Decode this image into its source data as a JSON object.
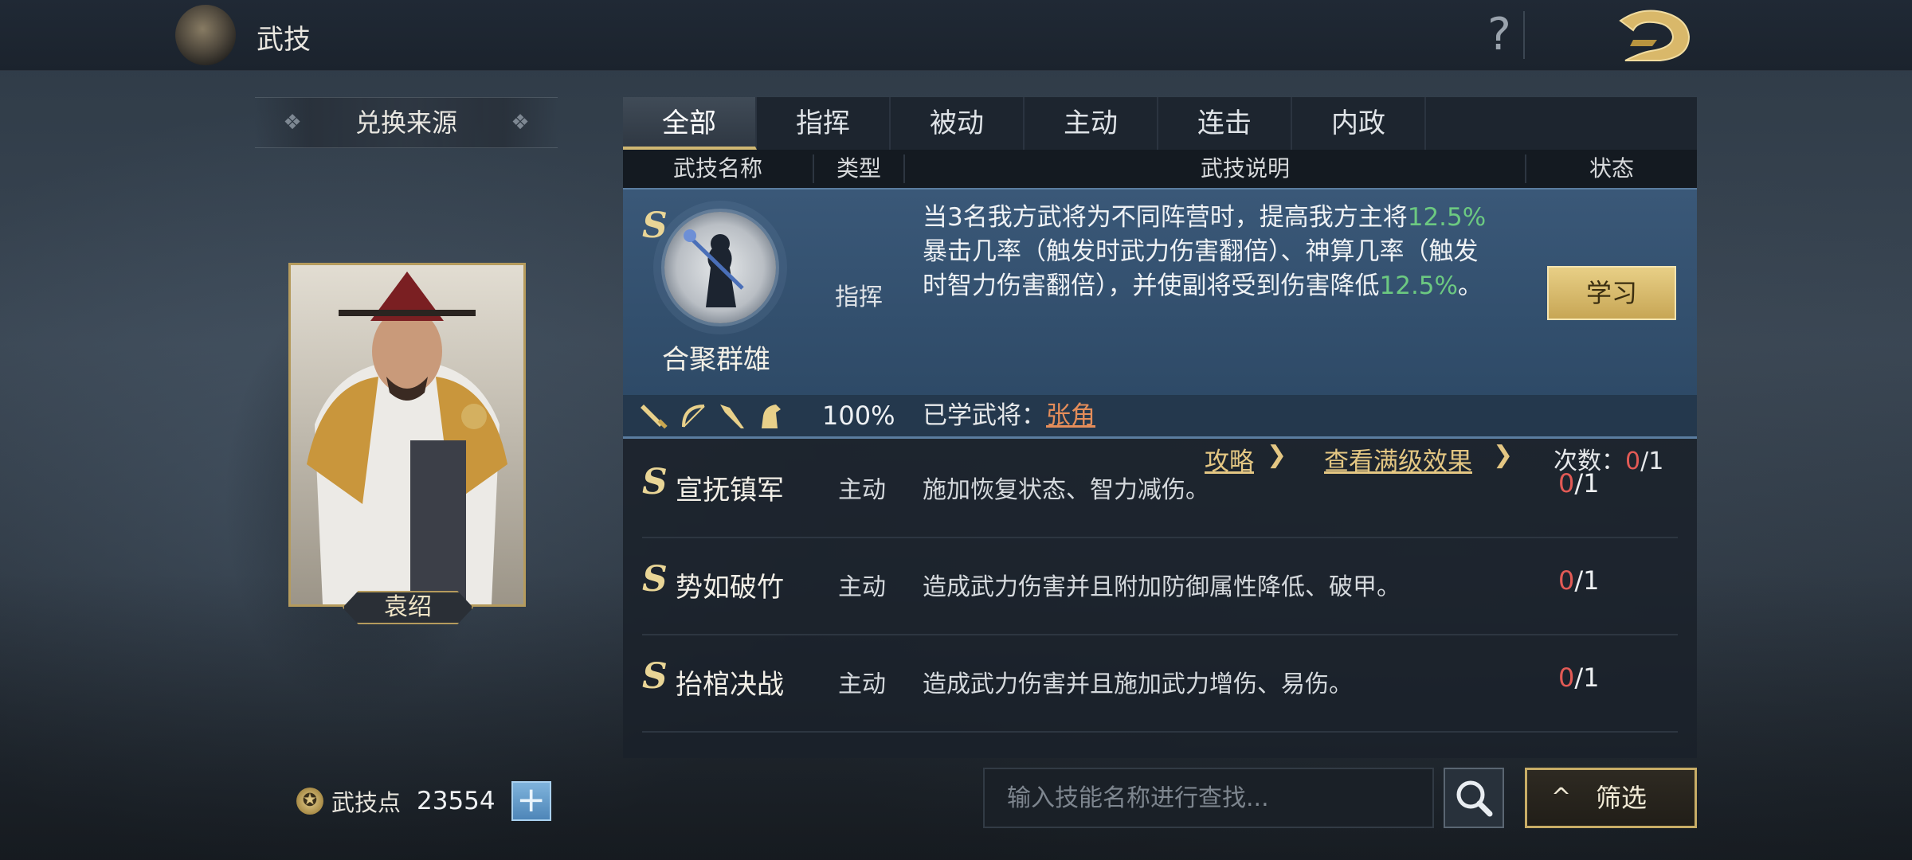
{
  "app": {
    "title": "武技"
  },
  "header": {
    "help_glyph": "?"
  },
  "left_panel": {
    "source_banner": "兑换来源",
    "general_name": "袁绍",
    "points_label": "武技点",
    "points_value": "23554",
    "add_glyph": "+"
  },
  "tabs": [
    {
      "label": "全部",
      "active": true
    },
    {
      "label": "指挥",
      "active": false
    },
    {
      "label": "被动",
      "active": false
    },
    {
      "label": "主动",
      "active": false
    },
    {
      "label": "连击",
      "active": false
    },
    {
      "label": "内政",
      "active": false
    }
  ],
  "columns": {
    "name": "武技名称",
    "type": "类型",
    "desc": "武技说明",
    "status": "状态"
  },
  "featured": {
    "grade": "S",
    "name": "合聚群雄",
    "type": "指挥",
    "desc_1": "当3名我方武将为不同阵营时，提高我方主将",
    "desc_hl_1": "12.5%",
    "desc_2": "暴击几率（触发时武力伤害翻倍）、神算几率（触发时智力伤害翻倍），并使副将受到伤害降低",
    "desc_hl_2": "12.5%",
    "desc_3": "。",
    "learn_button": "学习",
    "guide_link": "攻略",
    "full_effect_link": "查看满级效果",
    "count_label": "次数：",
    "count_used": "0",
    "count_total": "/1",
    "weapon_icons": [
      "sword-icon",
      "bow-icon",
      "spear-icon",
      "horse-icon"
    ],
    "percent": "100%",
    "learned_label": "已学武将：",
    "learned_general": "张角"
  },
  "rows": [
    {
      "grade": "S",
      "name": "宣抚镇军",
      "type": "主动",
      "desc": "施加恢复状态、智力减伤。",
      "used": "0",
      "total": "/1"
    },
    {
      "grade": "S",
      "name": "势如破竹",
      "type": "主动",
      "desc": "造成武力伤害并且附加防御属性降低、破甲。",
      "used": "0",
      "total": "/1"
    },
    {
      "grade": "S",
      "name": "抬棺决战",
      "type": "主动",
      "desc": "造成武力伤害并且施加武力增伤、易伤。",
      "used": "0",
      "total": "/1"
    }
  ],
  "search": {
    "placeholder": "输入技能名称进行查找..."
  },
  "filter": {
    "caret": "^",
    "label": "筛选"
  },
  "colors": {
    "accent_gold": "#c8ad66",
    "highlight_green": "#6cc981",
    "count_red": "#e25a55",
    "featured_bg": "#3a5878"
  }
}
